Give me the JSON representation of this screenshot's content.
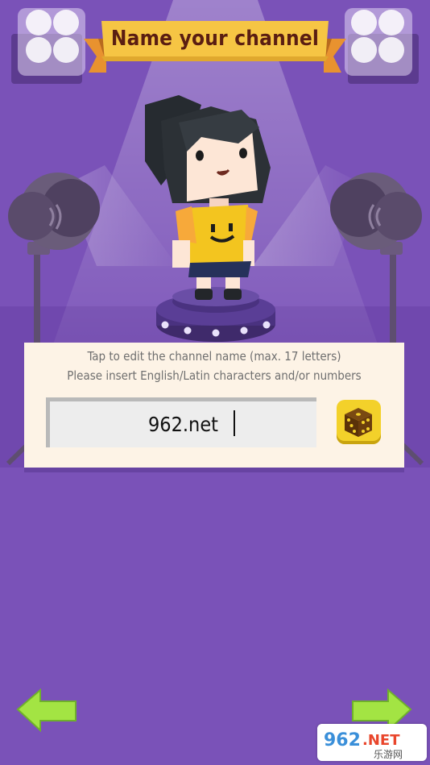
{
  "header": {
    "title": "Name your channel"
  },
  "panel": {
    "hint_line_1": "Tap to edit the channel name (max. 17 letters)",
    "hint_line_2": "Please insert English/Latin characters and/or numbers",
    "channel_name_value": "962.net",
    "channel_name_maxlength": "17"
  },
  "buttons": {
    "randomize_icon": "dice-icon",
    "back_icon": "arrow-left-icon",
    "next_icon": "arrow-right-icon"
  },
  "watermark": {
    "text": "962.NET 乐游网"
  },
  "colors": {
    "background": "#7a52b8",
    "banner": "#f6c544",
    "banner_ribbon": "#e8922f",
    "title_text": "#5a1e12",
    "panel": "#fdf3e6",
    "arrow": "#a3e443",
    "dice": "#f3d12a",
    "shirt": "#f3c51f"
  }
}
